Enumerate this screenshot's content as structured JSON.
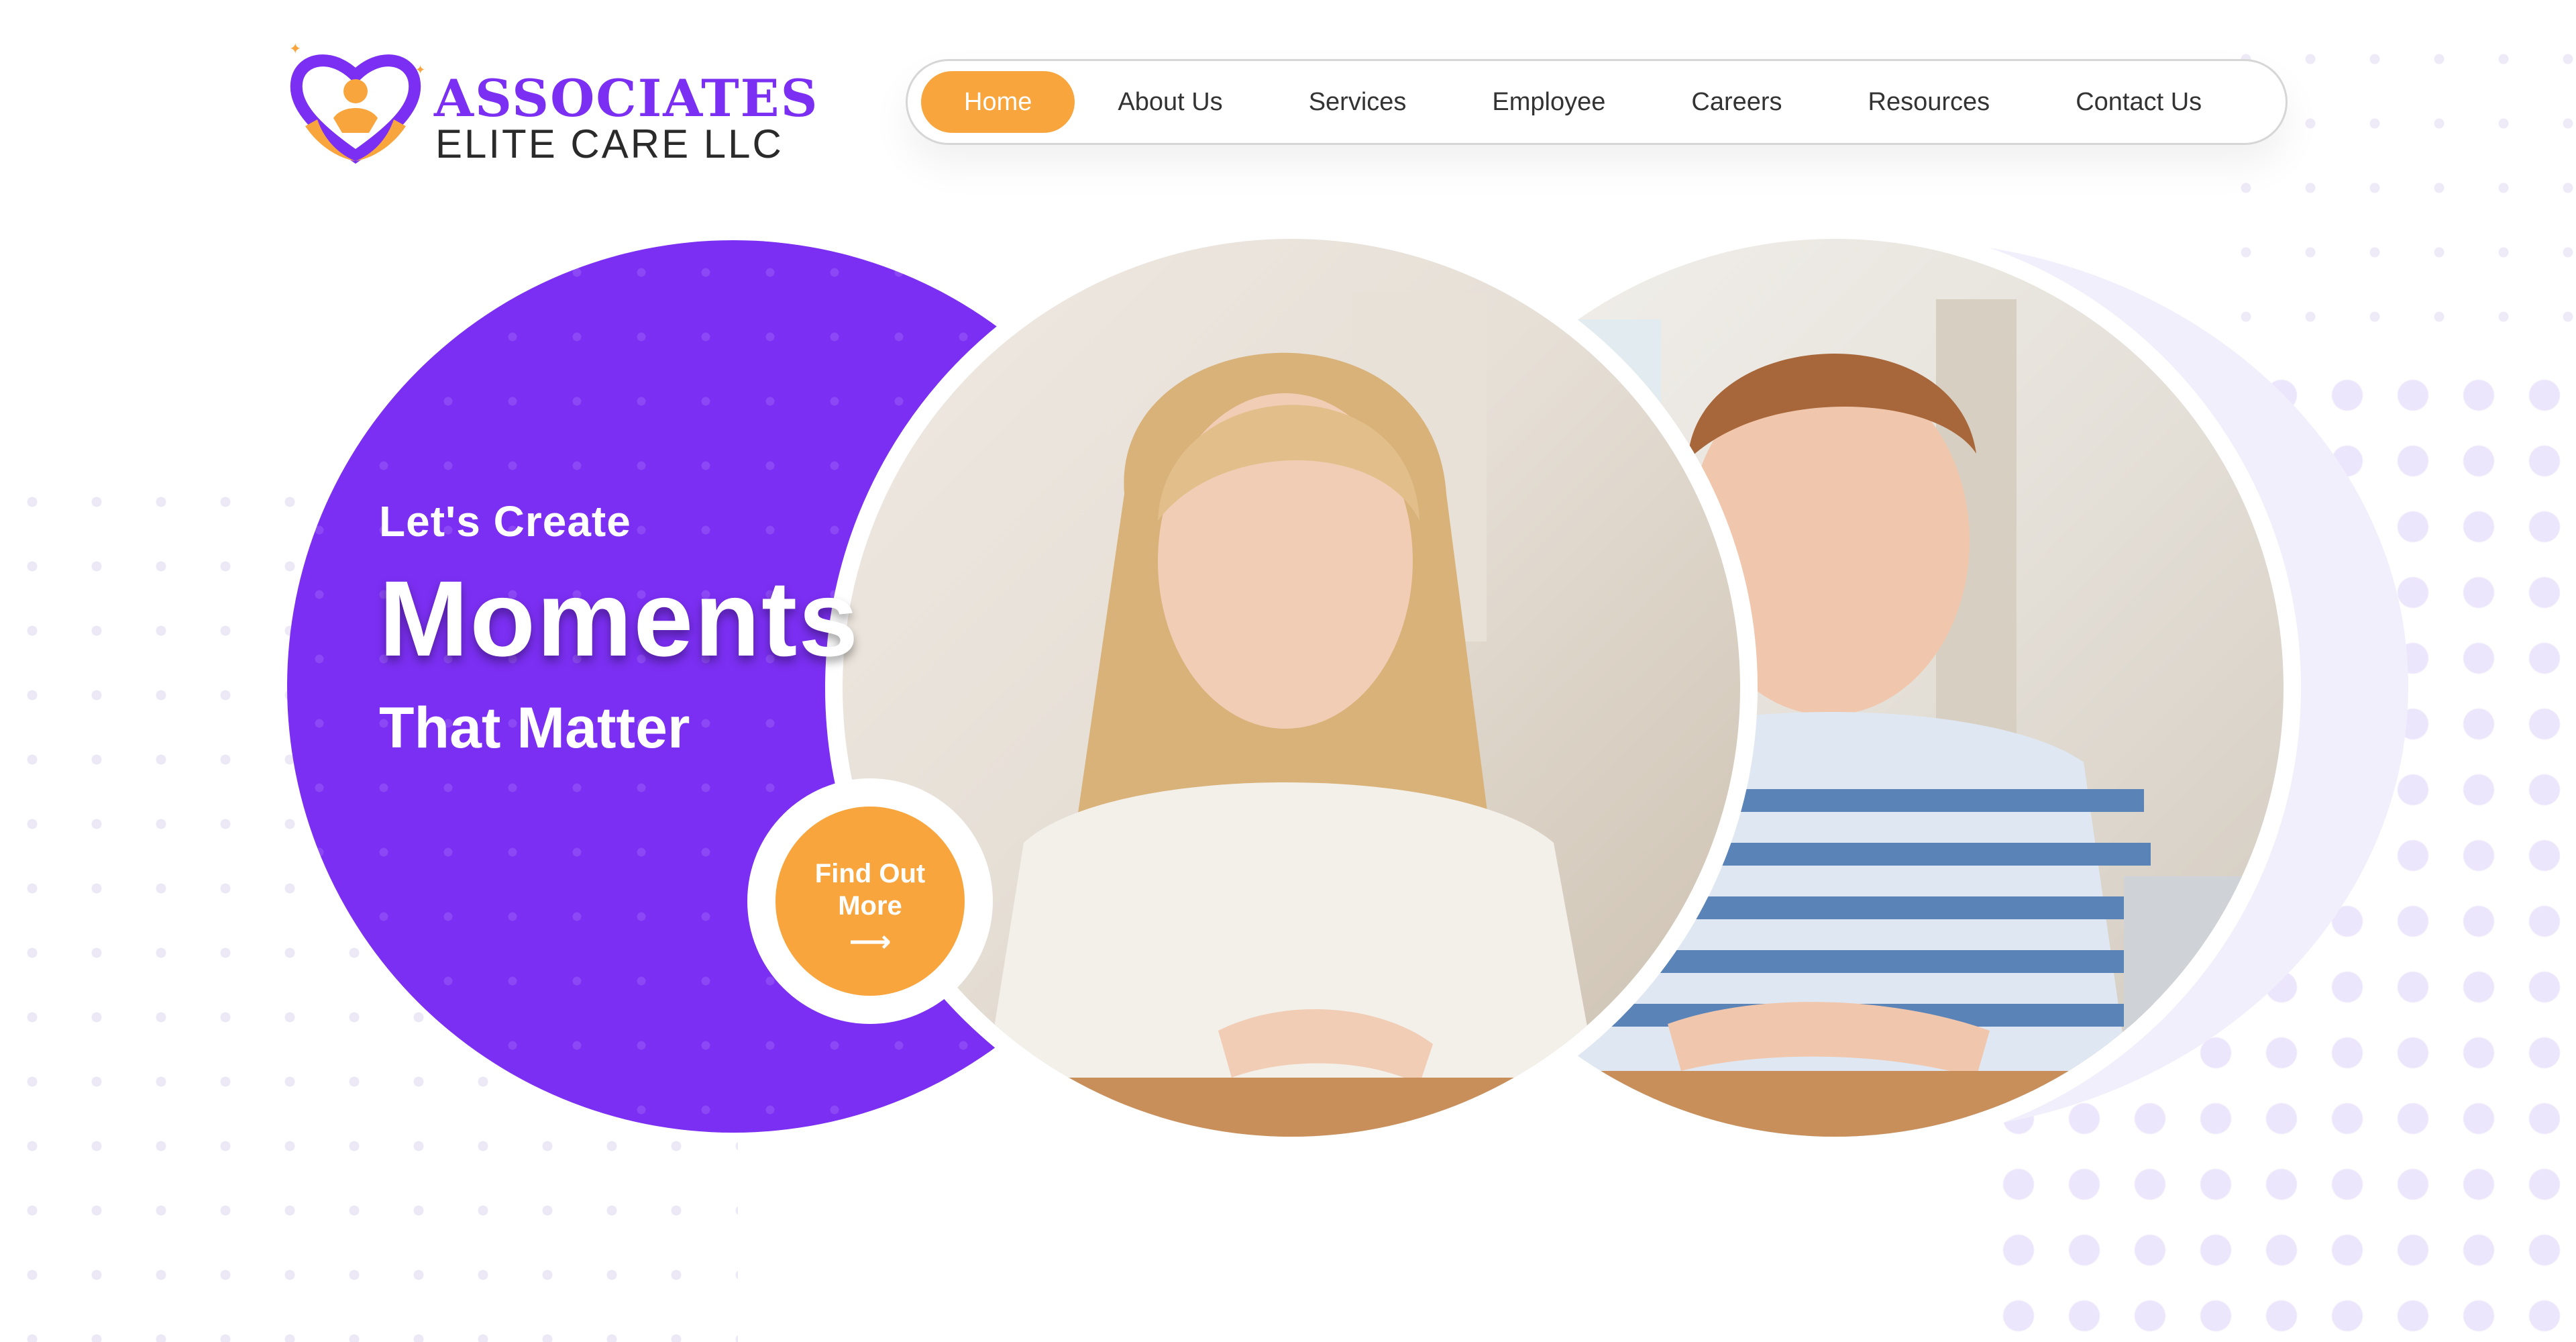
{
  "brand": {
    "name_line1": "ASSOCIATES",
    "name_line2": "ELITE CARE LLC",
    "colors": {
      "purple": "#7b2ff2",
      "orange": "#f8a53e",
      "lavender": "#f2effc"
    },
    "logo_icon": "heart-hands-person-icon"
  },
  "nav": {
    "items": [
      {
        "label": "Home",
        "active": true
      },
      {
        "label": "About Us"
      },
      {
        "label": "Services"
      },
      {
        "label": "Employee"
      },
      {
        "label": "Careers"
      },
      {
        "label": "Resources"
      },
      {
        "label": "Contact Us"
      }
    ]
  },
  "hero": {
    "line1": "Let's Create",
    "line2": "Moments",
    "line3": "That Matter",
    "cta_label_1": "Find Out",
    "cta_label_2": "More",
    "cta_arrow": "⟶"
  }
}
